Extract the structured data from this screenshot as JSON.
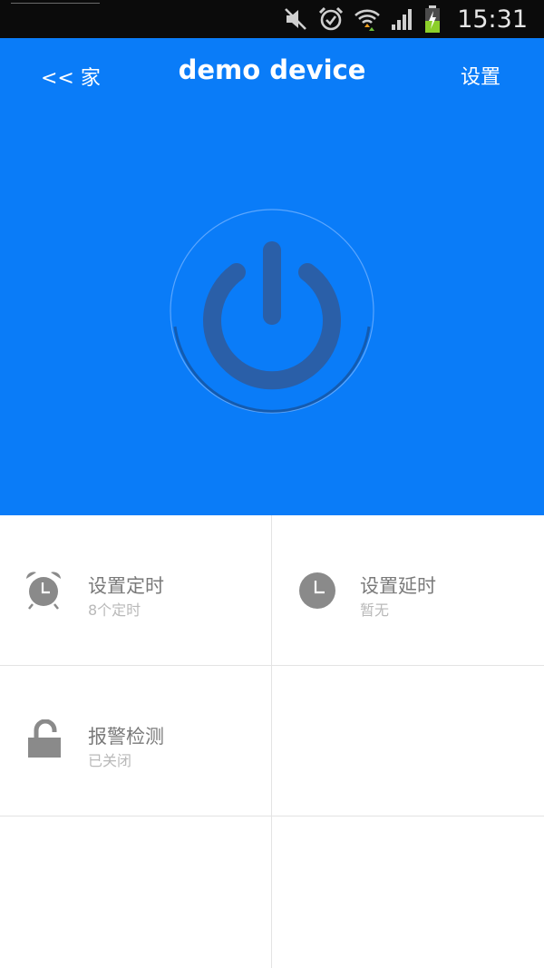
{
  "status_bar": {
    "time": "15:31",
    "icons": [
      "mute-icon",
      "alarm-icon",
      "wifi-icon",
      "signal-icon",
      "battery-charging-icon"
    ]
  },
  "header": {
    "back_label": "<< 家",
    "title": "demo device",
    "settings_label": "设置"
  },
  "power": {
    "icon": "power-icon"
  },
  "colors": {
    "primary_blue": "#0a7cf8",
    "icon_dark_blue": "#2a5fa8",
    "grid_icon_gray": "#8a8a8a"
  },
  "tiles": [
    {
      "icon": "alarm-clock-icon",
      "title": "设置定时",
      "subtitle": "8个定时"
    },
    {
      "icon": "clock-icon",
      "title": "设置延时",
      "subtitle": "暂无"
    },
    {
      "icon": "unlock-icon",
      "title": "报警检测",
      "subtitle": "已关闭"
    }
  ]
}
